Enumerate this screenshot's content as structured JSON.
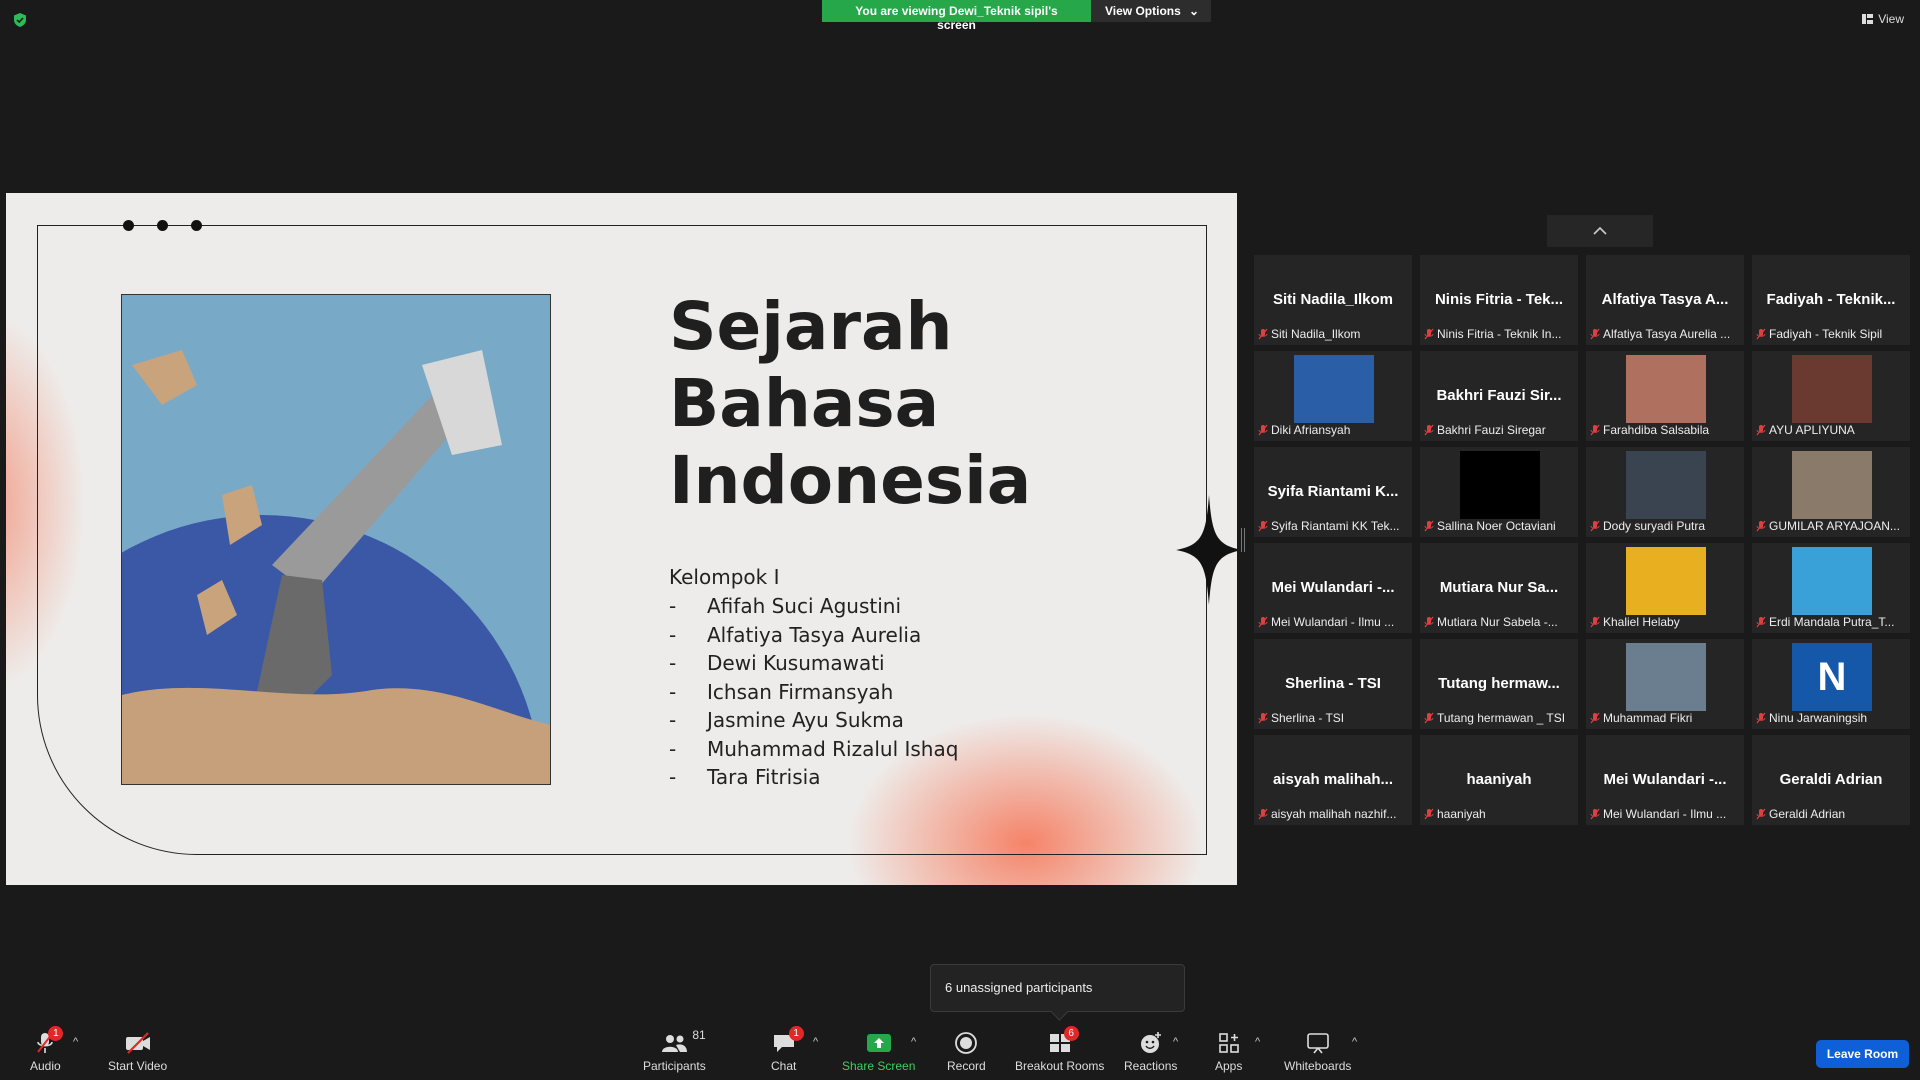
{
  "banner": {
    "viewing": "You are viewing Dewi_Teknik sipil's screen",
    "view_options": "View Options",
    "view": "View"
  },
  "slide": {
    "title_lines": [
      "Sejarah",
      "Bahasa",
      "Indonesia"
    ],
    "group_heading": "Kelompok I",
    "members": [
      "Afifah Suci Agustini",
      "Alfatiya Tasya Aurelia",
      "Dewi Kusumawati",
      "Ichsan Firmansyah",
      "Jasmine Ayu Sukma",
      "Muhammad Rizalul Ishaq",
      "Tara Fitrisia"
    ],
    "dash": "-"
  },
  "gallery": {
    "tiles": [
      {
        "big": "Siti Nadila_Ilkom",
        "label": "Siti Nadila_Ilkom"
      },
      {
        "big": "Ninis Fitria - Tek...",
        "label": "Ninis Fitria - Teknik In..."
      },
      {
        "big": "Alfatiya Tasya A...",
        "label": "Alfatiya Tasya Aurelia ..."
      },
      {
        "big": "Fadiyah - Teknik...",
        "label": "Fadiyah - Teknik Sipil"
      },
      {
        "video": "person-photo",
        "color": "#2a5fa8",
        "label": "Diki Afriansyah"
      },
      {
        "big": "Bakhri Fauzi Sir...",
        "label": "Bakhri Fauzi Siregar"
      },
      {
        "video": "person-photo",
        "color": "#b07060",
        "label": "Farahdiba Salsabila"
      },
      {
        "video": "person-photo",
        "color": "#6a3a30",
        "label": "AYU APLIYUNA"
      },
      {
        "big": "Syifa Riantami K...",
        "label": "Syifa Riantami KK Tek..."
      },
      {
        "video": "black-screen",
        "color": "#000000",
        "label": "Sallina Noer Octaviani"
      },
      {
        "video": "person-photo",
        "color": "#3a4450",
        "label": "Dody suryadi Putra"
      },
      {
        "video": "person-photo",
        "color": "#8a7a6a",
        "label": "GUMILAR ARYAJOAN..."
      },
      {
        "big": "Mei Wulandari -...",
        "label": "Mei Wulandari - Ilmu ..."
      },
      {
        "big": "Mutiara Nur Sa...",
        "label": "Mutiara Nur Sabela -..."
      },
      {
        "video": "person-photo",
        "color": "#e8b020",
        "label": "Khaliel Helaby"
      },
      {
        "video": "person-photo",
        "color": "#3aa0d8",
        "label": "Erdi Mandala Putra_T..."
      },
      {
        "big": "Sherlina - TSI",
        "label": "Sherlina - TSI"
      },
      {
        "big": "Tutang hermaw...",
        "label": "Tutang hermawan _ TSI"
      },
      {
        "video": "person-photo",
        "color": "#6a7e90",
        "label": "Muhammad Fikri"
      },
      {
        "initial": "N",
        "label": "Ninu Jarwaningsih"
      },
      {
        "big": "aisyah malihah...",
        "label": "aisyah malihah nazhif..."
      },
      {
        "big": "haaniyah",
        "label": "haaniyah"
      },
      {
        "big": "Mei Wulandari -...",
        "label": "Mei Wulandari - Ilmu ..."
      },
      {
        "big": "Geraldi Adrian",
        "label": "Geraldi Adrian"
      }
    ]
  },
  "tooltip": "6 unassigned participants",
  "toolbar": {
    "audio": "Audio",
    "audio_badge": "1",
    "video": "Start Video",
    "participants": "Participants",
    "participants_count": "81",
    "chat": "Chat",
    "chat_badge": "1",
    "share": "Share Screen",
    "record": "Record",
    "breakout": "Breakout Rooms",
    "breakout_badge": "6",
    "reactions": "Reactions",
    "apps": "Apps",
    "whiteboards": "Whiteboards",
    "leave": "Leave Room"
  },
  "colors": {
    "accent_green": "#26a74a",
    "leave_blue": "#0e5fd8",
    "badge_red": "#e02828"
  }
}
